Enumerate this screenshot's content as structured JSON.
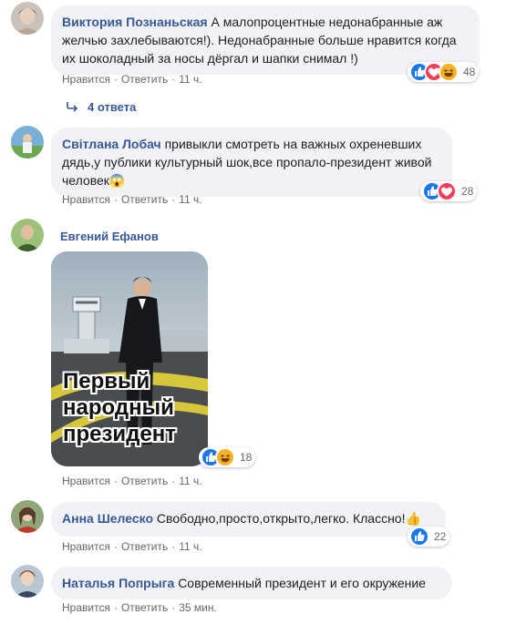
{
  "ui": {
    "like": "Нравится",
    "reply": "Ответить",
    "sep": "·"
  },
  "comments": [
    {
      "author": "Виктория Познаньская",
      "text": "А малопроцентные недонабранные аж желчью захлебываются!). Недонабранные больше нравится когда их шоколадный за носы дёргал и шапки снимал !)",
      "time": "11 ч.",
      "reactions": [
        "like",
        "love",
        "haha"
      ],
      "reaction_count": "48",
      "replies": "4 ответа"
    },
    {
      "author": "Світлана Лобач",
      "text": "привыкли смотреть на важных охреневших дядь,у публики культурный шок,все пропало-президент живой человек😱",
      "time": "11 ч.",
      "reactions": [
        "like",
        "love"
      ],
      "reaction_count": "28"
    },
    {
      "author": "Евгений Ефанов",
      "image_caption": [
        "Первый",
        "народный",
        "президент"
      ],
      "time": "11 ч.",
      "reactions": [
        "like",
        "haha"
      ],
      "reaction_count": "18"
    },
    {
      "author": "Анна Шелеско",
      "text": "Свободно,просто,открыто,легко. Классно!👍",
      "time": "11 ч.",
      "reactions": [
        "like"
      ],
      "reaction_count": "22"
    },
    {
      "author": "Наталья Попрыга",
      "text": "Современный президент и его окружение",
      "time": "35 мин."
    }
  ],
  "colors": {
    "link": "#385898",
    "bubble": "#f0f2f5",
    "meta": "#65676b",
    "like": "#1877f2",
    "love": "#f33e58",
    "haha": "#f7b125"
  }
}
